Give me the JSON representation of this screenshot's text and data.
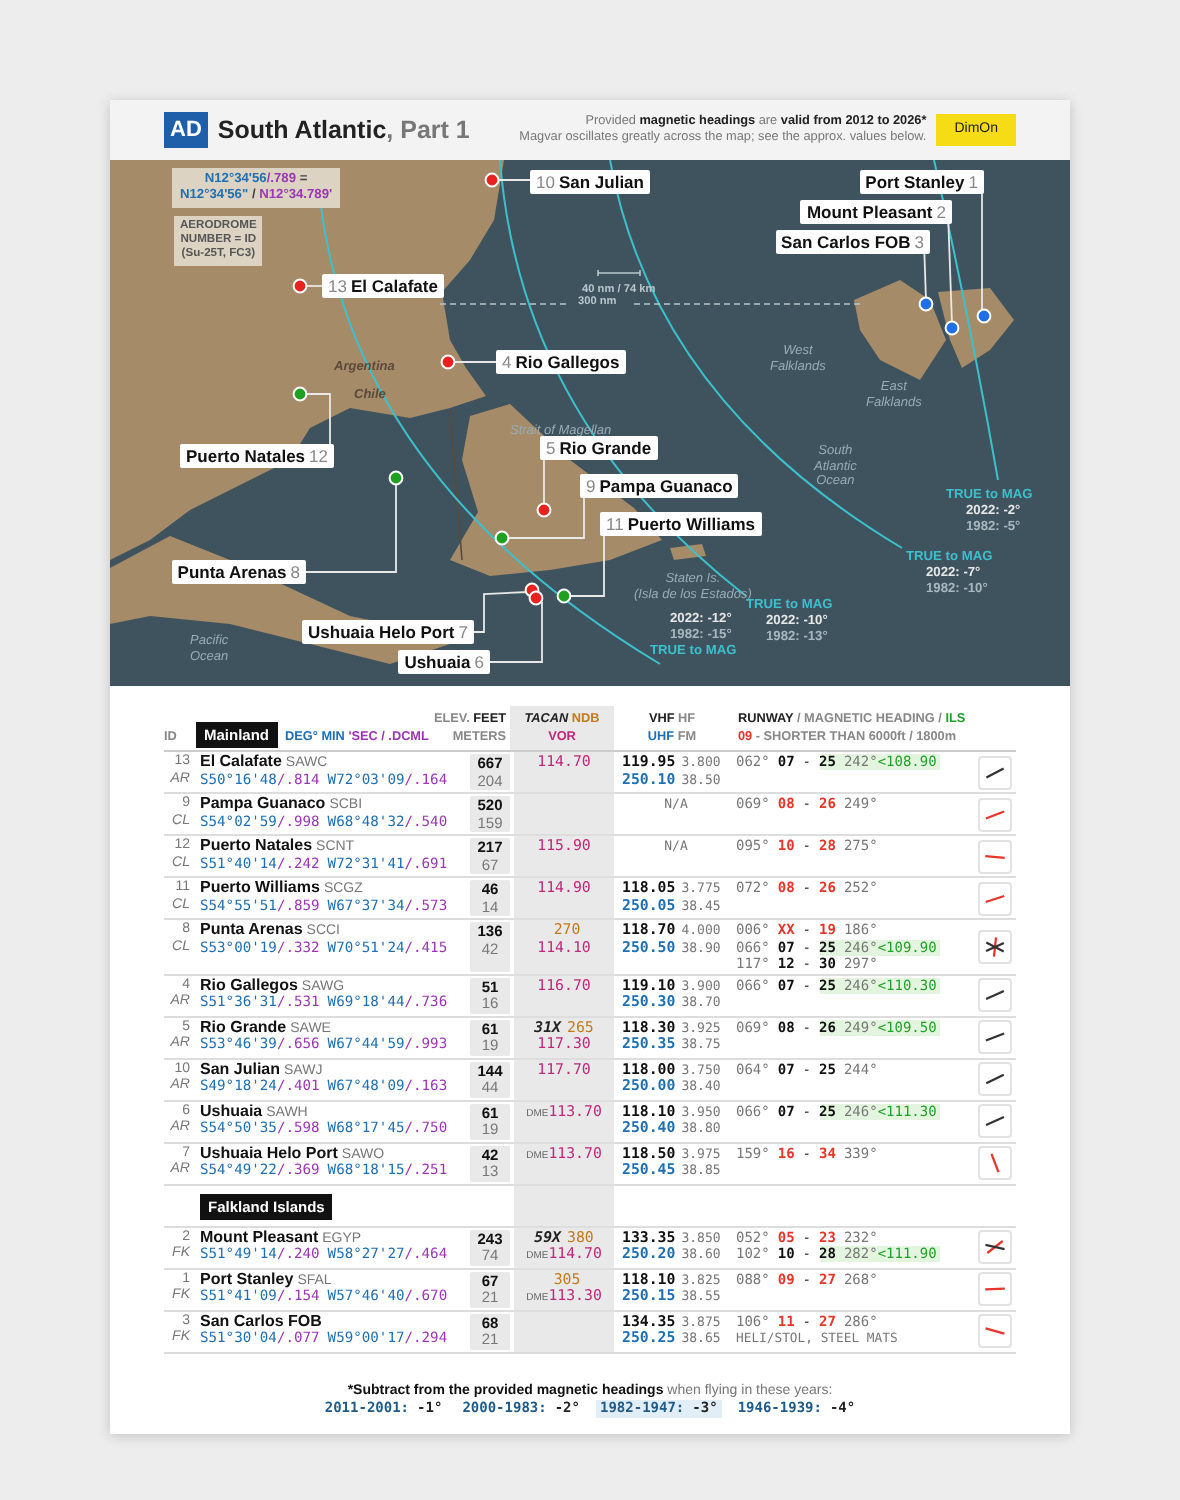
{
  "header": {
    "badge": "AD",
    "title": "South Atlantic",
    "title_suffix": ", Part 1",
    "notes": [
      [
        {
          "text": "Provided ",
          "kind": "plain"
        },
        {
          "text": "magnetic headings",
          "kind": "strong"
        },
        {
          "text": " are ",
          "kind": "plain"
        },
        {
          "text": "valid from 2012 to 2026*",
          "kind": "strong"
        }
      ],
      [
        {
          "text": "Magvar oscillates greatly across the map; see the approx. values below.",
          "kind": "plain"
        }
      ]
    ],
    "brand": "DimOn"
  },
  "map": {
    "legend_coordinates": [
      [
        {
          "text": "N12°34'56",
          "kind": "dms"
        },
        {
          "text": "/.789",
          "kind": "dcml"
        },
        {
          "text": " =",
          "kind": "plain"
        }
      ],
      [
        {
          "text": "N12°34'56\"",
          "kind": "dms"
        },
        {
          "text": " / ",
          "kind": "plain"
        },
        {
          "text": "N12°34.789'",
          "kind": "dcml"
        }
      ]
    ],
    "legend_id": [
      "AERODROME",
      "NUMBER = ID",
      "(Su-25T, FC3)"
    ],
    "scale": "40 nm / 74 km",
    "distance": "300 nm",
    "regions": [
      {
        "lines": [
          "Argentina"
        ],
        "kind": "land"
      },
      {
        "lines": [
          "Chile"
        ],
        "kind": "land"
      },
      {
        "lines": [
          "Strait of Magellan"
        ],
        "kind": "water"
      },
      {
        "lines": [
          "West",
          "Falklands"
        ],
        "kind": "water"
      },
      {
        "lines": [
          "East",
          "Falklands"
        ],
        "kind": "water"
      },
      {
        "lines": [
          "South",
          "Atlantic",
          "Ocean"
        ],
        "kind": "water"
      },
      {
        "lines": [
          "Staten Is.",
          "(Isla de los Estados)"
        ],
        "kind": "water"
      },
      {
        "lines": [
          "Pacific",
          "Ocean"
        ],
        "kind": "water"
      }
    ],
    "airfields": [
      {
        "id": "10",
        "name": "San Julian",
        "color": "#e8231f"
      },
      {
        "id": "1",
        "name": "Port Stanley",
        "color": "#1f6fe8"
      },
      {
        "id": "2",
        "name": "Mount Pleasant",
        "color": "#1f6fe8"
      },
      {
        "id": "3",
        "name": "San Carlos FOB",
        "color": "#1f6fe8"
      },
      {
        "id": "13",
        "name": "El Calafate",
        "color": "#e8231f"
      },
      {
        "id": "4",
        "name": "Rio Gallegos",
        "color": "#e8231f"
      },
      {
        "id": "12",
        "name": "Puerto Natales",
        "color": "#20a020"
      },
      {
        "id": "5",
        "name": "Rio Grande",
        "color": "#e8231f"
      },
      {
        "id": "9",
        "name": "Pampa Guanaco",
        "color": "#20a020"
      },
      {
        "id": "11",
        "name": "Puerto Williams",
        "color": "#20a020"
      },
      {
        "id": "8",
        "name": "Punta Arenas",
        "color": "#20a020"
      },
      {
        "id": "7",
        "name": "Ushuaia Helo Port",
        "color": "#e8231f"
      },
      {
        "id": "6",
        "name": "Ushuaia",
        "color": "#e8231f"
      }
    ],
    "isogonic_lines": [
      {
        "label": "TRUE to MAG",
        "values": [
          "2022: -2°",
          "1982: -5°"
        ]
      },
      {
        "label": "TRUE to MAG",
        "values": [
          "2022: -7°",
          "1982: -10°"
        ]
      },
      {
        "label": "TRUE to MAG",
        "values": [
          "2022: -10°",
          "1982: -13°"
        ]
      },
      {
        "label": "TRUE to MAG",
        "values": [
          "2022: -12°",
          "1982: -15°"
        ]
      }
    ]
  },
  "table": {
    "header": {
      "id": "ID",
      "coordinates": [
        {
          "text": "DEG° MIN ",
          "kind": "dms"
        },
        {
          "text": "'SEC / .DCML",
          "kind": "dcml"
        }
      ],
      "elevation": [
        [
          {
            "text": "ELEV. ",
            "kind": "muted"
          },
          {
            "text": "FEET",
            "kind": "strong"
          }
        ],
        [
          {
            "text": "METERS",
            "kind": "muted"
          }
        ]
      ],
      "navaids": [
        [
          {
            "text": "TACAN",
            "kind": "tacan"
          },
          {
            "text": " NDB",
            "kind": "ndb"
          }
        ],
        [
          {
            "text": "VOR",
            "kind": "vor"
          }
        ]
      ],
      "radio": [
        [
          {
            "text": "VHF",
            "kind": "strong"
          },
          {
            "text": " HF",
            "kind": "muted"
          }
        ],
        [
          {
            "text": "UHF",
            "kind": "uhf"
          },
          {
            "text": " FM",
            "kind": "muted"
          }
        ]
      ],
      "runway": [
        [
          {
            "text": "RUNWAY",
            "kind": "strong"
          },
          {
            "text": " / MAGNETIC HEADING / ",
            "kind": "muted"
          },
          {
            "text": "ILS",
            "kind": "ils"
          }
        ],
        [
          {
            "text": "09",
            "kind": "short"
          },
          {
            "text": " - SHORTER THAN 6000ft / 1800m",
            "kind": "muted"
          }
        ]
      ]
    },
    "sections": [
      {
        "title": "Mainland",
        "rows": [
          {
            "id": "13",
            "country": "AR",
            "name": "El Calafate",
            "icao": "SAWC",
            "lat": "S50°16'48",
            "lat_dcml": "/.814",
            "lon": "W72°03'09",
            "lon_dcml": "/.164",
            "feet": "667",
            "meters": "204",
            "vor": "114.70",
            "vhf": "119.95",
            "hf": "3.800",
            "uhf": "250.10",
            "fm": "38.50",
            "runways": [
              {
                "heading": "062°",
                "low": "07",
                "dash": "-",
                "high": "25",
                "reverse": "242°",
                "ils": "<108.90",
                "short": false
              }
            ]
          },
          {
            "id": "9",
            "country": "CL",
            "name": "Pampa Guanaco",
            "icao": "SCBI",
            "lat": "S54°02'59",
            "lat_dcml": "/.998",
            "lon": "W68°48'32",
            "lon_dcml": "/.540",
            "feet": "520",
            "meters": "159",
            "radio_note": "N/A",
            "runways": [
              {
                "heading": "069°",
                "low": "08",
                "dash": "-",
                "high": "26",
                "reverse": "249°",
                "short": true
              }
            ]
          },
          {
            "id": "12",
            "country": "CL",
            "name": "Puerto Natales",
            "icao": "SCNT",
            "lat": "S51°40'14",
            "lat_dcml": "/.242",
            "lon": "W72°31'41",
            "lon_dcml": "/.691",
            "feet": "217",
            "meters": "67",
            "vor": "115.90",
            "radio_note": "N/A",
            "runways": [
              {
                "heading": "095°",
                "low": "10",
                "dash": "-",
                "high": "28",
                "reverse": "275°",
                "short": true
              }
            ]
          },
          {
            "id": "11",
            "country": "CL",
            "name": "Puerto Williams",
            "icao": "SCGZ",
            "lat": "S54°55'51",
            "lat_dcml": "/.859",
            "lon": "W67°37'34",
            "lon_dcml": "/.573",
            "feet": "46",
            "meters": "14",
            "vor": "114.90",
            "vhf": "118.05",
            "hf": "3.775",
            "uhf": "250.05",
            "fm": "38.45",
            "runways": [
              {
                "heading": "072°",
                "low": "08",
                "dash": "-",
                "high": "26",
                "reverse": "252°",
                "short": true
              }
            ]
          },
          {
            "id": "8",
            "country": "CL",
            "name": "Punta Arenas",
            "icao": "SCCI",
            "lat": "S53°00'19",
            "lat_dcml": "/.332",
            "lon": "W70°51'24",
            "lon_dcml": "/.415",
            "feet": "136",
            "meters": "42",
            "ndb": "270",
            "vor": "114.10",
            "vhf": "118.70",
            "hf": "4.000",
            "uhf": "250.50",
            "fm": "38.90",
            "runways": [
              {
                "heading": "006°",
                "low": "XX",
                "dash": "-",
                "high": "19",
                "reverse": "186°",
                "short": true
              },
              {
                "heading": "066°",
                "low": "07",
                "dash": "-",
                "high": "25",
                "reverse": "246°",
                "ils": "<109.90",
                "short": false
              },
              {
                "heading": "117°",
                "low": "12",
                "dash": "-",
                "high": "30",
                "reverse": "297°",
                "short": false
              }
            ]
          },
          {
            "id": "4",
            "country": "AR",
            "name": "Rio Gallegos",
            "icao": "SAWG",
            "lat": "S51°36'31",
            "lat_dcml": "/.531",
            "lon": "W69°18'44",
            "lon_dcml": "/.736",
            "feet": "51",
            "meters": "16",
            "vor": "116.70",
            "vhf": "119.10",
            "hf": "3.900",
            "uhf": "250.30",
            "fm": "38.70",
            "runways": [
              {
                "heading": "066°",
                "low": "07",
                "dash": "-",
                "high": "25",
                "reverse": "246°",
                "ils": "<110.30",
                "short": false
              }
            ]
          },
          {
            "id": "5",
            "country": "AR",
            "name": "Rio Grande",
            "icao": "SAWE",
            "lat": "S53°46'39",
            "lat_dcml": "/.656",
            "lon": "W67°44'59",
            "lon_dcml": "/.993",
            "feet": "61",
            "meters": "19",
            "tacan": "31X",
            "ndb": "265",
            "vor": "117.30",
            "vhf": "118.30",
            "hf": "3.925",
            "uhf": "250.35",
            "fm": "38.75",
            "runways": [
              {
                "heading": "069°",
                "low": "08",
                "dash": "-",
                "high": "26",
                "reverse": "249°",
                "ils": "<109.50",
                "short": false
              }
            ]
          },
          {
            "id": "10",
            "country": "AR",
            "name": "San Julian",
            "icao": "SAWJ",
            "lat": "S49°18'24",
            "lat_dcml": "/.401",
            "lon": "W67°48'09",
            "lon_dcml": "/.163",
            "feet": "144",
            "meters": "44",
            "vor": "117.70",
            "vhf": "118.00",
            "hf": "3.750",
            "uhf": "250.00",
            "fm": "38.40",
            "runways": [
              {
                "heading": "064°",
                "low": "07",
                "dash": "-",
                "high": "25",
                "reverse": "244°",
                "short": false
              }
            ]
          },
          {
            "id": "6",
            "country": "AR",
            "name": "Ushuaia",
            "icao": "SAWH",
            "lat": "S54°50'35",
            "lat_dcml": "/.598",
            "lon": "W68°17'45",
            "lon_dcml": "/.750",
            "feet": "61",
            "meters": "19",
            "vor_prefix": "DME",
            "vor": "113.70",
            "vhf": "118.10",
            "hf": "3.950",
            "uhf": "250.40",
            "fm": "38.80",
            "runways": [
              {
                "heading": "066°",
                "low": "07",
                "dash": "-",
                "high": "25",
                "reverse": "246°",
                "ils": "<111.30",
                "short": false
              }
            ]
          },
          {
            "id": "7",
            "country": "AR",
            "name": "Ushuaia Helo Port",
            "icao": "SAWO",
            "lat": "S54°49'22",
            "lat_dcml": "/.369",
            "lon": "W68°18'15",
            "lon_dcml": "/.251",
            "feet": "42",
            "meters": "13",
            "vor_prefix": "DME",
            "vor": "113.70",
            "vhf": "118.50",
            "hf": "3.975",
            "uhf": "250.45",
            "fm": "38.85",
            "runways": [
              {
                "heading": "159°",
                "low": "16",
                "dash": "-",
                "high": "34",
                "reverse": "339°",
                "short": true
              }
            ]
          }
        ]
      },
      {
        "title": "Falkland Islands",
        "rows": [
          {
            "id": "2",
            "country": "FK",
            "name": "Mount Pleasant",
            "icao": "EGYP",
            "lat": "S51°49'14",
            "lat_dcml": "/.240",
            "lon": "W58°27'27",
            "lon_dcml": "/.464",
            "feet": "243",
            "meters": "74",
            "tacan": "59X",
            "ndb": "380",
            "vor_prefix": "DME",
            "vor": "114.70",
            "vhf": "133.35",
            "hf": "3.850",
            "uhf": "250.20",
            "fm": "38.60",
            "runways": [
              {
                "heading": "052°",
                "low": "05",
                "dash": "-",
                "high": "23",
                "reverse": "232°",
                "short": true
              },
              {
                "heading": "102°",
                "low": "10",
                "dash": "-",
                "high": "28",
                "reverse": "282°",
                "ils": "<111.90",
                "short": false
              }
            ]
          },
          {
            "id": "1",
            "country": "FK",
            "name": "Port Stanley",
            "icao": "SFAL",
            "lat": "S51°41'09",
            "lat_dcml": "/.154",
            "lon": "W57°46'40",
            "lon_dcml": "/.670",
            "feet": "67",
            "meters": "21",
            "ndb": "305",
            "vor_prefix": "DME",
            "vor": "113.30",
            "vhf": "118.10",
            "hf": "3.825",
            "uhf": "250.15",
            "fm": "38.55",
            "runways": [
              {
                "heading": "088°",
                "low": "09",
                "dash": "-",
                "high": "27",
                "reverse": "268°",
                "short": true
              }
            ]
          },
          {
            "id": "3",
            "country": "FK",
            "name": "San Carlos FOB",
            "lat": "S51°30'04",
            "lat_dcml": "/.077",
            "lon": "W59°00'17",
            "lon_dcml": "/.294",
            "feet": "68",
            "meters": "21",
            "vhf": "134.35",
            "hf": "3.875",
            "uhf": "250.25",
            "fm": "38.65",
            "runways": [
              {
                "heading": "106°",
                "low": "11",
                "dash": "-",
                "high": "27",
                "reverse": "286°",
                "short": true
              }
            ],
            "runway_note": "HELI/STOL, STEEL MATS"
          }
        ]
      }
    ]
  },
  "footnote": {
    "lead": "*Subtract from the provided magnetic headings",
    "rest": " when flying in these years:",
    "years": [
      {
        "range": "2011-2001:",
        "value": "-1°",
        "highlighted": false
      },
      {
        "range": "2000-1983:",
        "value": "-2°",
        "highlighted": false
      },
      {
        "range": "1982-1947:",
        "value": "-3°",
        "highlighted": true
      },
      {
        "range": "1946-1939:",
        "value": "-4°",
        "highlighted": false
      }
    ]
  }
}
